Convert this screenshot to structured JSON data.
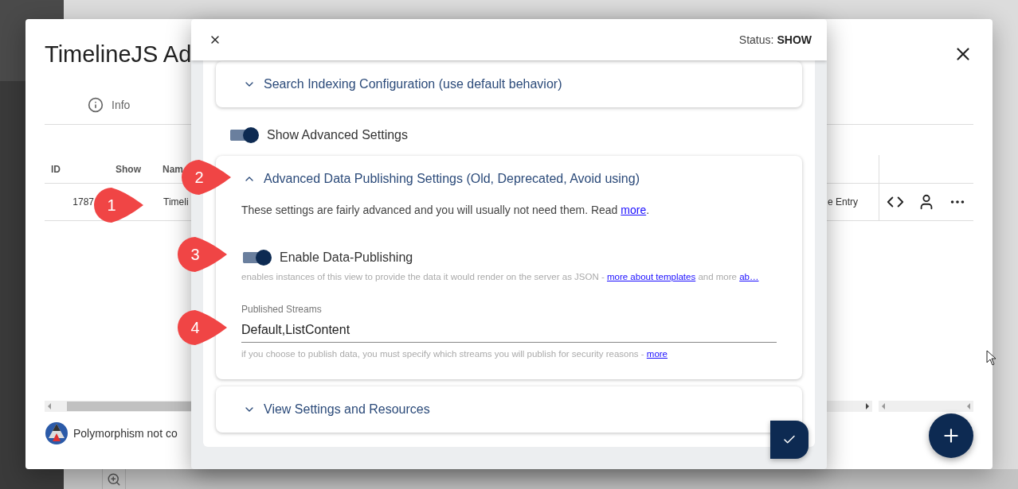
{
  "back_dialog": {
    "title": "TimelineJS Ad",
    "tabs": [
      {
        "label": "Info"
      }
    ],
    "table": {
      "columns": [
        "ID",
        "Show",
        "Nam"
      ],
      "rows": [
        {
          "id": "1787",
          "name": "Timeli",
          "last": "e Entry"
        }
      ]
    },
    "footer": "Polymorphism not co"
  },
  "editor": {
    "status_label": "Status:",
    "status_value": "SHOW",
    "items": [
      {
        "kind": "section",
        "title": "Search Indexing Configuration (use default behavior)",
        "expanded": false
      },
      {
        "kind": "toggle",
        "label": "Show Advanced Settings",
        "on": true
      },
      {
        "kind": "section",
        "title": "Advanced Data Publishing Settings (Old, Deprecated, Avoid using)",
        "expanded": true,
        "body": [
          {
            "kind": "text",
            "parts": [
              {
                "text": "These settings are fairly advanced and you will usually not need them. Read "
              },
              {
                "link": "more"
              },
              {
                "text": "."
              }
            ]
          },
          {
            "kind": "toggle",
            "label": "Enable Data-Publishing",
            "on": true,
            "hint": [
              {
                "text": "enables instances of this view to provide the data it would render on the server as JSON - "
              },
              {
                "link": "more about templates"
              },
              {
                "text": " and more "
              },
              {
                "link": "ab…"
              }
            ]
          },
          {
            "kind": "field",
            "label": "Published Streams",
            "value": "Default,ListContent",
            "hint": [
              {
                "text": "if you choose to publish data, you must specify which streams you will publish for security reasons - "
              },
              {
                "link": "more"
              }
            ]
          }
        ]
      },
      {
        "kind": "section",
        "title": "View Settings and Resources",
        "expanded": false
      }
    ]
  },
  "callouts": [
    "1",
    "2",
    "3",
    "4"
  ]
}
